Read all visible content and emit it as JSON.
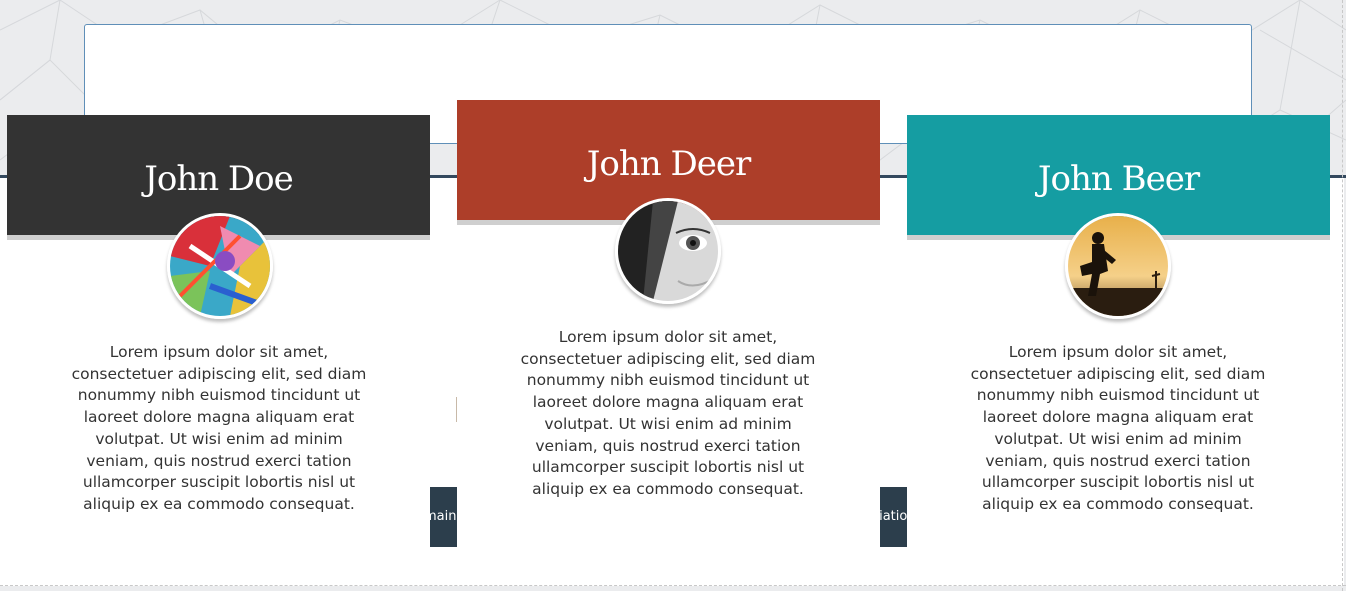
{
  "cards": [
    {
      "name": "John Doe",
      "color": "#333333",
      "photo": "abstract-paint-photo",
      "text": "Lorem ipsum dolor sit amet, consectetuer adipiscing elit, sed diam nonummy nibh euismod tincidunt ut laoreet dolore magna aliquam erat volutpat. Ut wisi enim ad minim veniam, quis nostrud exerci tation ullamcorper suscipit lobortis nisl ut aliquip ex ea commodo consequat."
    },
    {
      "name": "John Deer",
      "color": "#ad3e29",
      "photo": "face-eye-photo",
      "text": "Lorem ipsum dolor sit amet, consectetuer adipiscing elit, sed diam nonummy nibh euismod tincidunt ut laoreet dolore magna aliquam erat volutpat. Ut wisi enim ad minim veniam, quis nostrud exerci tation ullamcorper suscipit lobortis nisl ut aliquip ex ea commodo consequat."
    },
    {
      "name": "John Beer",
      "color": "#159da2",
      "photo": "silhouette-sunset-photo",
      "text": "Lorem ipsum dolor sit amet, consectetuer adipiscing elit, sed diam nonummy nibh euismod tincidunt ut laoreet dolore magna aliquam erat volutpat. Ut wisi enim ad minim veniam, quis nostrud exerci tation ullamcorper suscipit lobortis nisl ut aliquip ex ea commodo consequat."
    }
  ],
  "hidden_tabs": {
    "left": "main,",
    "right": "tiatio"
  }
}
